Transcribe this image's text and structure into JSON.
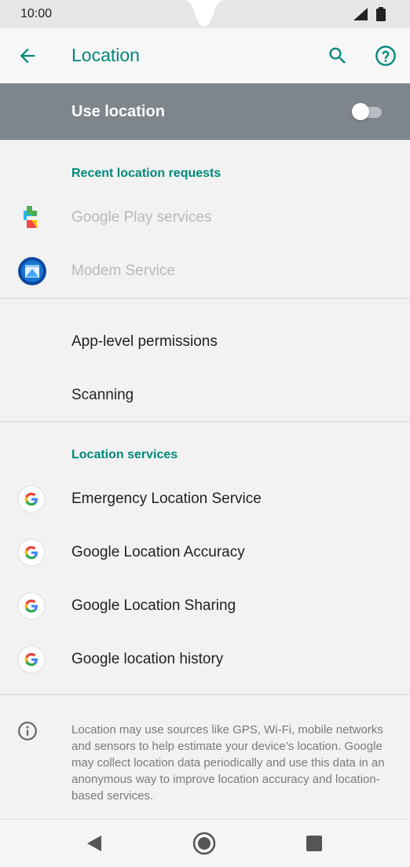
{
  "status_bar": {
    "time": "10:00"
  },
  "app_bar": {
    "title": "Location"
  },
  "master_switch": {
    "label": "Use location",
    "state": "off"
  },
  "recent_requests": {
    "header": "Recent location requests",
    "items": [
      {
        "label": "Google Play services",
        "icon": "google-play-services-icon"
      },
      {
        "label": "Modem Service",
        "icon": "modem-service-icon"
      }
    ]
  },
  "settings": {
    "items": [
      {
        "label": "App-level permissions"
      },
      {
        "label": "Scanning"
      }
    ]
  },
  "location_services": {
    "header": "Location services",
    "items": [
      {
        "label": "Emergency Location Service",
        "icon": "google-g-icon"
      },
      {
        "label": "Google Location Accuracy",
        "icon": "google-g-icon"
      },
      {
        "label": "Google Location Sharing",
        "icon": "google-g-icon"
      },
      {
        "label": "Google location history",
        "icon": "google-g-icon"
      }
    ]
  },
  "footer": {
    "text": "Location may use sources like GPS, Wi-Fi, mobile networks and sensors to help estimate your device’s location. Google may collect location data periodically and use this data in an anonymous way to improve location accuracy and location-based services."
  },
  "colors": {
    "accent": "#00897b",
    "master_bg": "#7e858c"
  }
}
